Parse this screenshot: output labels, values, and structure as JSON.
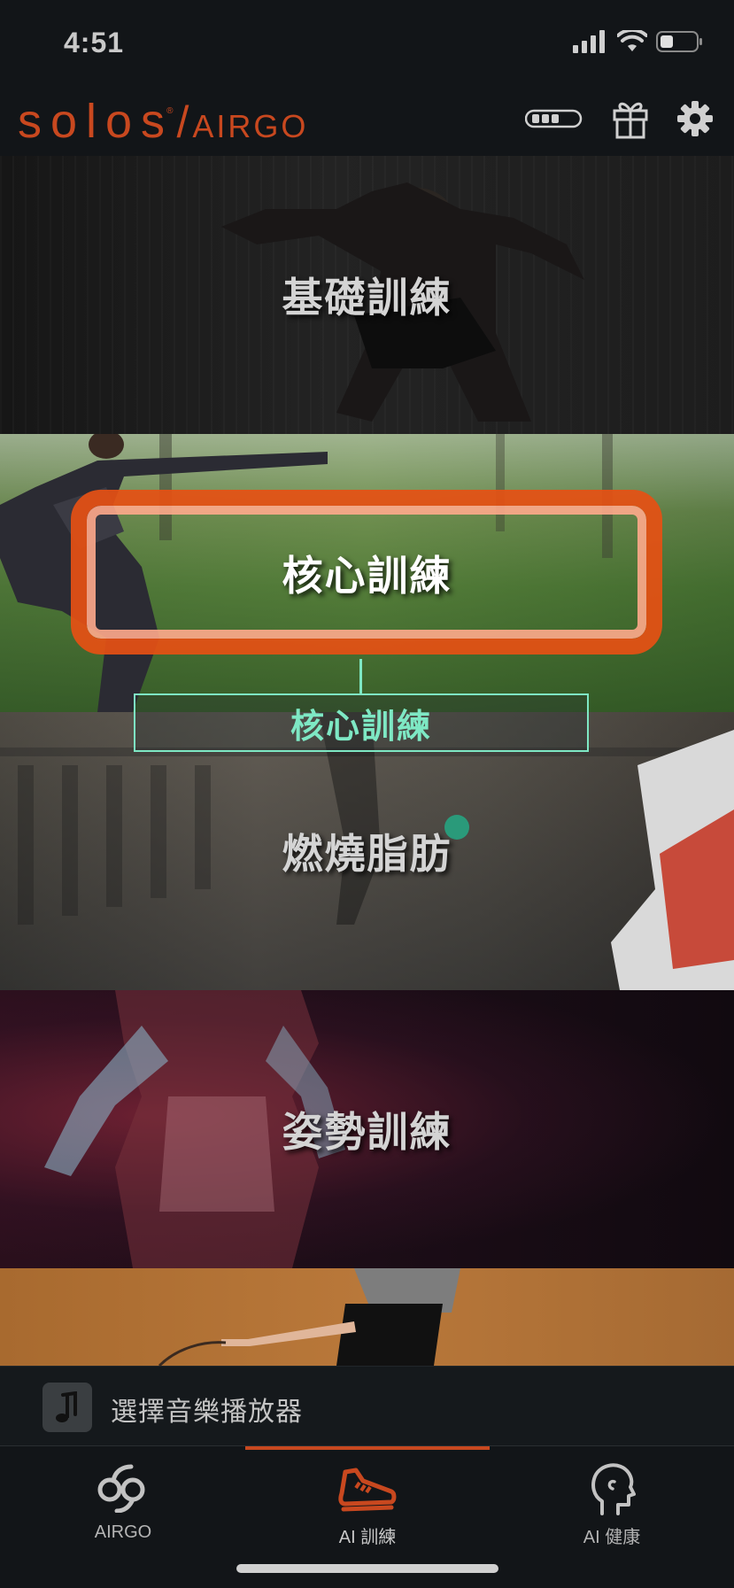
{
  "status_bar": {
    "time": "4:51"
  },
  "header": {
    "logo_brand": "solos",
    "logo_registered": "®",
    "logo_separator": "/",
    "logo_product": "AIRGO"
  },
  "categories": [
    {
      "label": "基礎訓練"
    },
    {
      "label": "核心訓練"
    },
    {
      "label": "燃燒脂肪"
    },
    {
      "label": "姿勢訓練"
    },
    {
      "label": ""
    }
  ],
  "annotation": {
    "label": "核心訓練"
  },
  "music_bar": {
    "label": "選擇音樂播放器",
    "icon": "music-note-icon"
  },
  "tabs": [
    {
      "label": "AIRGO",
      "icon": "airgo-logo-icon",
      "active": false
    },
    {
      "label": "AI 訓練",
      "icon": "running-shoe-icon",
      "active": true
    },
    {
      "label": "AI 健康",
      "icon": "head-profile-icon",
      "active": false
    }
  ],
  "colors": {
    "accent": "#c8481f",
    "highlight_ring": "#e65014",
    "annotation": "#7ee8c4",
    "background": "#121518"
  }
}
